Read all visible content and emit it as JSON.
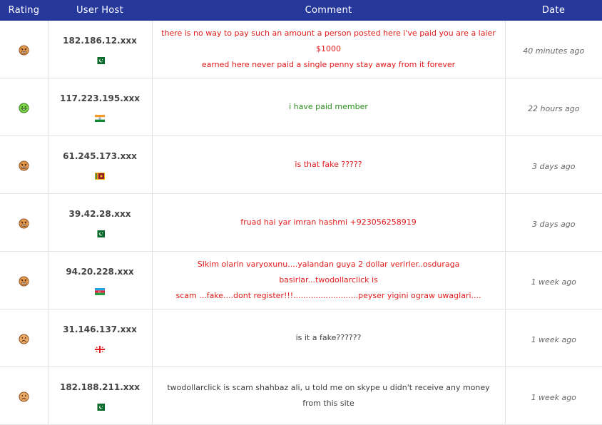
{
  "header": {
    "rating": "Rating",
    "host": "User Host",
    "comment": "Comment",
    "date": "Date"
  },
  "colors": {
    "negative_comment": "#e01b1b",
    "positive_comment": "#2a8a1c",
    "neutral_comment": "#3d3d3d",
    "header_bg": "#27389b"
  },
  "rows": [
    {
      "rating_icon": "angry-face-icon",
      "ip": "182.186.12.xxx",
      "flag_icon": "pakistan-flag-icon",
      "comment_lines": [
        "there is no way to pay such an amount a person posted here i've paid you are a laier $1000",
        "earned here never paid a single penny stay away from it forever"
      ],
      "date": "40 minutes ago"
    },
    {
      "rating_icon": "happy-face-icon",
      "ip": "117.223.195.xxx",
      "flag_icon": "india-flag-icon",
      "comment_lines": [
        "i have paid member"
      ],
      "date": "22 hours ago"
    },
    {
      "rating_icon": "angry-face-icon",
      "ip": "61.245.173.xxx",
      "flag_icon": "sri-lanka-flag-icon",
      "comment_lines": [
        "is that fake ?????"
      ],
      "date": "3 days ago"
    },
    {
      "rating_icon": "angry-face-icon",
      "ip": "39.42.28.xxx",
      "flag_icon": "pakistan-flag-icon",
      "comment_lines": [
        "fruad hai yar imran hashmi +923056258919"
      ],
      "date": "3 days ago"
    },
    {
      "rating_icon": "angry-face-icon",
      "ip": "94.20.228.xxx",
      "flag_icon": "azerbaijan-flag-icon",
      "comment_lines": [
        "SIkim olarin varyoxunu....yalandan guya 2 dollar verirler..osduraga basirlar...twodollarclick is",
        "scam ...fake....dont register!!!..........................peyser yigini ograw uwaglari...."
      ],
      "date": "1 week ago"
    },
    {
      "rating_icon": "sad-face-icon",
      "ip": "31.146.137.xxx",
      "flag_icon": "georgia-flag-icon",
      "comment_lines": [
        "is it a fake??????"
      ],
      "date": "1 week ago"
    },
    {
      "rating_icon": "sad-face-icon",
      "ip": "182.188.211.xxx",
      "flag_icon": "pakistan-flag-icon",
      "comment_lines": [
        "twodollarclick is scam shahbaz ali, u told me on skype u didn't receive any money from this site"
      ],
      "date": "1 week ago"
    }
  ]
}
